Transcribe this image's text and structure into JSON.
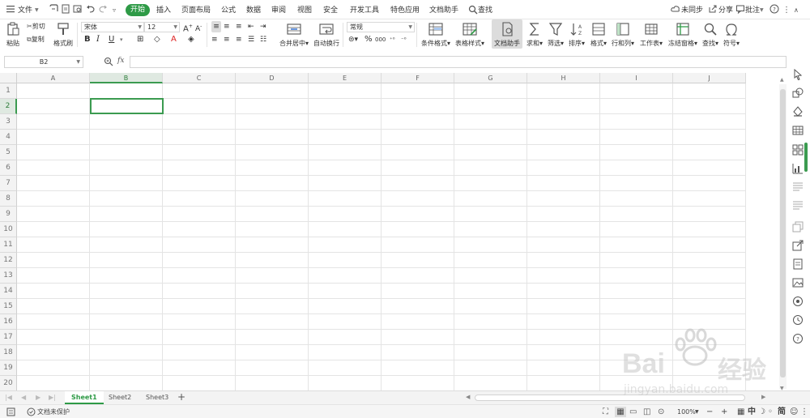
{
  "menubar": {
    "file_label": "文件",
    "tabs": [
      "开始",
      "插入",
      "页面布局",
      "公式",
      "数据",
      "审阅",
      "视图",
      "安全",
      "开发工具",
      "特色应用",
      "文档助手"
    ],
    "search_label": "查找",
    "sync_label": "未同步",
    "share_label": "分享",
    "comment_label": "批注"
  },
  "ribbon": {
    "paste": "粘贴",
    "cut": "剪切",
    "copy": "复制",
    "format_painter": "格式刷",
    "font_name": "宋体",
    "font_size": "12",
    "merge_center": "合并居中",
    "wrap_text": "自动换行",
    "number_format": "常规",
    "conditional_format": "条件格式",
    "table_style": "表格样式",
    "doc_assistant": "文档助手",
    "sum": "求和",
    "filter": "筛选",
    "sort": "排序",
    "format": "格式",
    "rows_cols": "行和列",
    "worksheet": "工作表",
    "freeze": "冻结窗格",
    "find": "查找",
    "symbol": "符号"
  },
  "formula_bar": {
    "name_box": "B2",
    "fx": "fx",
    "value": ""
  },
  "grid": {
    "columns": [
      "A",
      "B",
      "C",
      "D",
      "E",
      "F",
      "G",
      "H",
      "I",
      "J"
    ],
    "rows": [
      "1",
      "2",
      "3",
      "4",
      "5",
      "6",
      "7",
      "8",
      "9",
      "10",
      "11",
      "12",
      "13",
      "14",
      "15",
      "16",
      "17",
      "18",
      "19",
      "20"
    ],
    "selected_cell": "B2"
  },
  "sheets": {
    "tabs": [
      "Sheet1",
      "Sheet2",
      "Sheet3"
    ],
    "active": "Sheet1",
    "add_label": "+"
  },
  "statusbar": {
    "protect_label": "文档未保护",
    "zoom": "100%",
    "ime_label": "中",
    "ime_mode": "简"
  },
  "watermark": {
    "brand": "Bai",
    "brand_cn": "经验",
    "url": "jingyan.baidu.com"
  },
  "colors": {
    "accent": "#2e9a46",
    "selection": "#3b9b50",
    "header_bg": "#f3f3f3",
    "gridline": "#e4e4e4"
  }
}
